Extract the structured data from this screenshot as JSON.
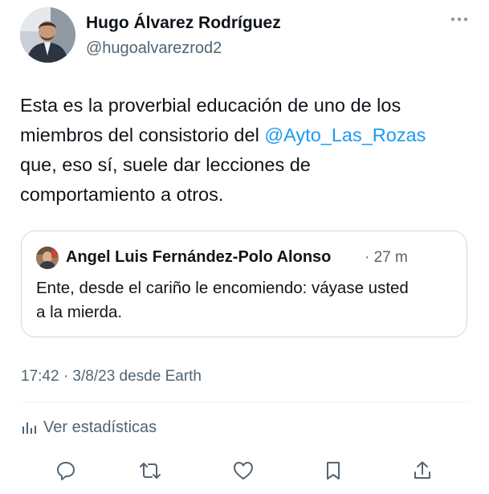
{
  "author": {
    "name": "Hugo Álvarez Rodríguez",
    "handle": "@hugoalvarezrod2"
  },
  "tweet": {
    "lines": [
      {
        "text": "Esta es la proverbial educación de uno de los"
      },
      {
        "before": "miembros del consistorio del ",
        "mention": "@Ayto_Las_Rozas"
      },
      {
        "text": "que, eso sí, suele dar lecciones de"
      },
      {
        "text": "comportamiento a otros."
      }
    ]
  },
  "quote": {
    "author_name": "Angel Luis Fernández-Polo Alonso",
    "meta": "· 27 m",
    "lines": [
      "Ente, desde el cariño le encomiendo: váyase usted",
      "a la mierda."
    ]
  },
  "timestamp": "17:42 · 3/8/23 desde Earth",
  "stats_label": "Ver estadísticas",
  "icons": {
    "more": "more-icon",
    "stats": "bar-chart-icon",
    "reply": "reply-icon",
    "retweet": "retweet-icon",
    "like": "heart-icon",
    "bookmark": "bookmark-icon",
    "share": "share-icon"
  },
  "colors": {
    "text": "#0f1419",
    "secondary": "#536471",
    "mention": "#1d9bf0",
    "border": "#cfd9de"
  }
}
